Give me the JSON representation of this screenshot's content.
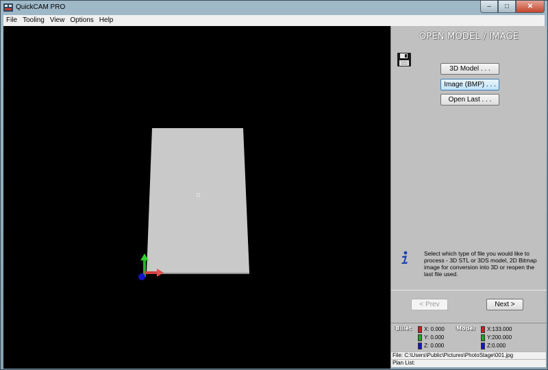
{
  "window": {
    "title": "QuickCAM PRO",
    "minimize": "–",
    "maximize": "□",
    "close": "✕"
  },
  "menu": [
    "File",
    "Tooling",
    "View",
    "Options",
    "Help"
  ],
  "panel": {
    "title": "OPEN MODEL / IMAGE",
    "buttons": [
      "3D Model . . .",
      "Image (BMP) . . .",
      "Open Last . . ."
    ],
    "info": "Select which type of file you would like to process - 3D STL or 3DS model, 2D Bitmap image for conversion into 3D or reopen the last file used.",
    "prev": "< Prev",
    "next": "Next >"
  },
  "coords": {
    "billet": {
      "label": "Billet",
      "x": "X: 0.000",
      "y": "Y: 0.000",
      "z": "Z: 0.000"
    },
    "model": {
      "label": "Model",
      "x": "X:133.000",
      "y": "Y:200.000",
      "z": "Z:0.000"
    },
    "colors": {
      "x": "#d11d1d",
      "y": "#1ea21e",
      "z": "#1414c8"
    }
  },
  "status": {
    "file": "File: C:\\Users\\Public\\Pictures\\PhotoStage\\001.jpg",
    "plan": "Plan List:"
  },
  "icons": {
    "app": "app-icon",
    "save": "floppy-disk-icon",
    "info": "info-icon",
    "axes": "axis-gizmo-icon"
  }
}
